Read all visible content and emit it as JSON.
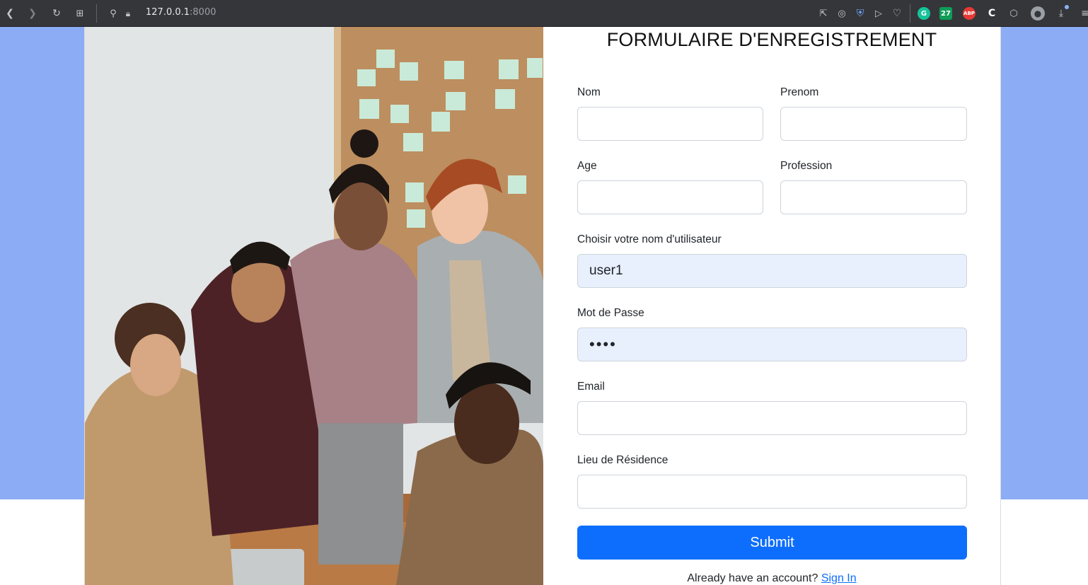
{
  "browser": {
    "url_host": "127.0.0.1",
    "url_port": ":8000",
    "icons": [
      "back-icon",
      "forward-icon",
      "reload-icon",
      "tab-grid-icon",
      "site-info-icon",
      "lock-icon"
    ],
    "extensions": [
      {
        "name": "grammarly-extension-icon",
        "label": "G",
        "color": "#15c39a"
      },
      {
        "name": "calendar-extension-icon",
        "label": "27",
        "color": "#0f9d58"
      },
      {
        "name": "adblock-plus-extension-icon",
        "label": "ABP",
        "color": "#e53935"
      }
    ]
  },
  "form": {
    "title": "FORMULAIRE D'ENREGISTREMENT",
    "fields": {
      "nom": {
        "label": "Nom",
        "value": ""
      },
      "prenom": {
        "label": "Prenom",
        "value": ""
      },
      "age": {
        "label": "Age",
        "value": ""
      },
      "profession": {
        "label": "Profession",
        "value": ""
      },
      "username": {
        "label": "Choisir votre nom d'utilisateur",
        "value": "user1"
      },
      "password": {
        "label": "Mot de Passe",
        "value": "••••"
      },
      "email": {
        "label": "Email",
        "value": ""
      },
      "residence": {
        "label": "Lieu de Résidence",
        "value": ""
      }
    },
    "submit_label": "Submit",
    "footer_text": "Already have an account?",
    "signin_label": "Sign In"
  },
  "colors": {
    "page_background": "#8cacf5",
    "primary_button": "#0d6efd",
    "autofill_background": "#e8f0fe"
  }
}
